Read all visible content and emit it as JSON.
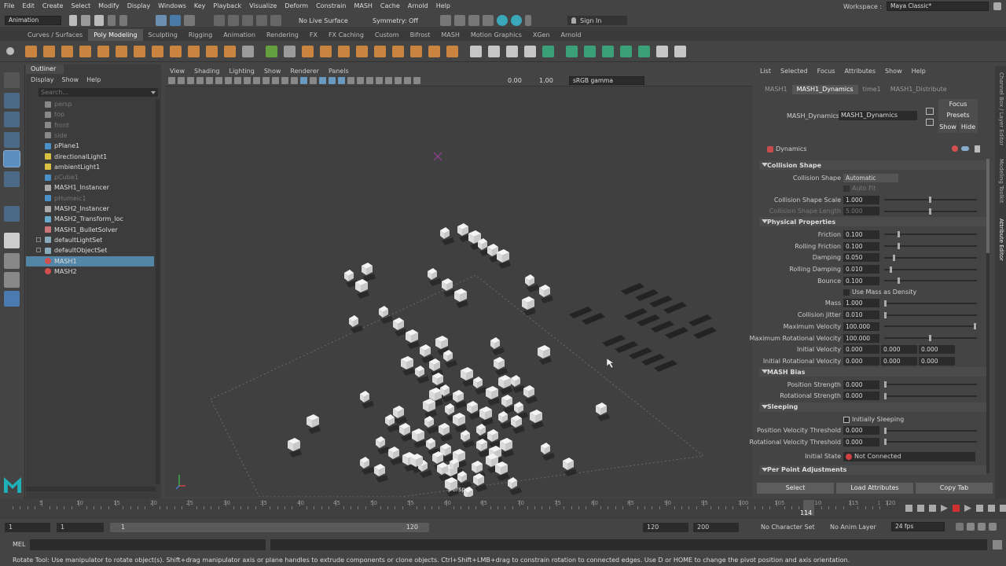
{
  "menus": [
    "File",
    "Edit",
    "Create",
    "Select",
    "Modify",
    "Display",
    "Windows",
    "Key",
    "Playback",
    "Visualize",
    "Deform",
    "Constrain",
    "MASH",
    "Cache",
    "Arnold",
    "Help"
  ],
  "workspace": {
    "label": "Workspace :",
    "value": "Maya Classic*"
  },
  "status": {
    "mode": "Animation",
    "live_surface": "No Live Surface",
    "symmetry": "Symmetry: Off",
    "sign_in": "Sign In"
  },
  "shelf_tabs": [
    "Curves / Surfaces",
    "Poly Modeling",
    "Sculpting",
    "Rigging",
    "Animation",
    "Rendering",
    "FX",
    "FX Caching",
    "Custom",
    "Bifrost",
    "MASH",
    "Motion Graphics",
    "XGen",
    "Arnold"
  ],
  "shelf_active": "Poly Modeling",
  "outliner": {
    "title": "Outliner",
    "menus": [
      "Display",
      "Show",
      "Help"
    ],
    "search_placeholder": "Search...",
    "items": [
      {
        "label": "persp",
        "dim": true,
        "icon": "camera-icon",
        "color": "#888"
      },
      {
        "label": "top",
        "dim": true,
        "icon": "camera-icon",
        "color": "#888"
      },
      {
        "label": "front",
        "dim": true,
        "icon": "camera-icon",
        "color": "#888"
      },
      {
        "label": "side",
        "dim": true,
        "icon": "camera-icon",
        "color": "#888"
      },
      {
        "label": "pPlane1",
        "dim": false,
        "icon": "mesh-icon",
        "color": "#4a90c8"
      },
      {
        "label": "directionalLight1",
        "dim": false,
        "icon": "light-icon",
        "color": "#d8c040"
      },
      {
        "label": "ambientLight1",
        "dim": false,
        "icon": "light-icon",
        "color": "#d8c040"
      },
      {
        "label": "pCube1",
        "dim": true,
        "icon": "mesh-icon",
        "color": "#4a90c8"
      },
      {
        "label": "MASH1_Instancer",
        "dim": false,
        "icon": "instancer-icon",
        "color": "#aaa"
      },
      {
        "label": "pHumeic1",
        "dim": true,
        "icon": "mesh-icon",
        "color": "#4a90c8"
      },
      {
        "label": "MASH2_Instancer",
        "dim": false,
        "icon": "instancer-icon",
        "color": "#aaa"
      },
      {
        "label": "MASH2_Transform_loc",
        "dim": false,
        "icon": "locator-icon",
        "color": "#6ac"
      },
      {
        "label": "MASH1_BulletSolver",
        "dim": false,
        "icon": "solver-icon",
        "color": "#c77"
      },
      {
        "label": "defaultLightSet",
        "dim": false,
        "icon": "set-icon",
        "color": "#8ab"
      },
      {
        "label": "defaultObjectSet",
        "dim": false,
        "icon": "set-icon",
        "color": "#8ab"
      },
      {
        "label": "MASH1",
        "dim": false,
        "icon": "mash-icon",
        "color": "#d05050",
        "selected": true
      },
      {
        "label": "MASH2",
        "dim": false,
        "icon": "mash-icon",
        "color": "#d05050"
      }
    ]
  },
  "viewport": {
    "menus": [
      "View",
      "Shading",
      "Lighting",
      "Show",
      "Renderer",
      "Panels"
    ],
    "val1": "0.00",
    "val2": "1.00",
    "colorspace": "sRGB gamma",
    "camera": "persp"
  },
  "ae": {
    "menus": [
      "List",
      "Selected",
      "Focus",
      "Attributes",
      "Show",
      "Help"
    ],
    "tabs": [
      "MASH1",
      "MASH1_Dynamics",
      "time1",
      "MASH1_Distribute"
    ],
    "node_label": "MASH_Dynamics:",
    "node_value": "MASH1_Dynamics",
    "btn_focus": "Focus",
    "btn_presets": "Presets",
    "btn_show": "Show",
    "btn_hide": "Hide",
    "header": "Dynamics",
    "sec_collision": "Collision Shape",
    "collision_shape_label": "Collision Shape",
    "collision_shape_value": "Automatic",
    "auto_fit": "Auto Fit",
    "scale_label": "Collision Shape Scale",
    "scale_value": "1.000",
    "length_label": "Collision Shape Length",
    "length_value": "5.000",
    "sec_physical": "Physical Properties",
    "physical": [
      {
        "label": "Friction",
        "value": "0.100",
        "level": 0.1
      },
      {
        "label": "Rolling Friction",
        "value": "0.100",
        "level": 0.1
      },
      {
        "label": "Damping",
        "value": "0.050",
        "level": 0.05
      },
      {
        "label": "Rolling Damping",
        "value": "0.010",
        "level": 0.01
      },
      {
        "label": "Bounce",
        "value": "0.100",
        "level": 0.1
      }
    ],
    "mass_density": "Use Mass as Density",
    "physical2": [
      {
        "label": "Mass",
        "value": "1.000",
        "level": 0.0
      },
      {
        "label": "Collision Jitter",
        "value": "0.010",
        "level": 0.0
      },
      {
        "label": "Maximum Velocity",
        "value": "100.000",
        "level": 1.0
      },
      {
        "label": "Maximum Rotational Velocity",
        "value": "100.000",
        "level": 0.5
      }
    ],
    "vectors": [
      {
        "label": "Initial Velocity",
        "values": [
          "0.000",
          "0.000",
          "0.000"
        ]
      },
      {
        "label": "Initial Rotational Velocity",
        "values": [
          "0.000",
          "0.000",
          "0.000"
        ]
      }
    ],
    "sec_bias": "MASH Bias",
    "bias": [
      {
        "label": "Position Strength",
        "value": "0.000"
      },
      {
        "label": "Rotational Strength",
        "value": "0.000"
      }
    ],
    "sec_sleeping": "Sleeping",
    "initially_sleeping": "Initially Sleeping",
    "sleeping": [
      {
        "label": "Position Velocity Threshold",
        "value": "0.000"
      },
      {
        "label": "Rotational Velocity Threshold",
        "value": "0.000"
      }
    ],
    "initial_state_label": "Initial State",
    "initial_state_value": "Not Connected",
    "sec_ppa": "Per Point Adjustments",
    "btn_select": "Select",
    "btn_load": "Load Attributes",
    "btn_copy": "Copy Tab",
    "side_tabs": [
      "Channel Box / Layer Editor",
      "Modeling Toolkit",
      "Attribute Editor"
    ]
  },
  "timeline": {
    "ticks": [
      "5",
      "10",
      "15",
      "20",
      "25",
      "30",
      "35",
      "40",
      "45",
      "50",
      "55",
      "60",
      "65",
      "70",
      "75",
      "80",
      "85",
      "90",
      "95",
      "100",
      "105",
      "110",
      "115",
      "120"
    ],
    "current": "114",
    "extra_tick": "1"
  },
  "range": {
    "start": "1",
    "inner_start": "1",
    "slider_start": "1",
    "slider_end": "120",
    "end": "120",
    "outer_end": "200",
    "char_set": "No Character Set",
    "anim_layer": "No Anim Layer",
    "fps": "24 fps"
  },
  "mel": {
    "label": "MEL"
  },
  "help": "Rotate Tool: Use manipulator to rotate object(s). Shift+drag manipulator axis or plane handles to extrude components or clone objects. Ctrl+Shift+LMB+drag to constrain rotation to connected edges. Use D or HOME to change the pivot position and axis orientation."
}
